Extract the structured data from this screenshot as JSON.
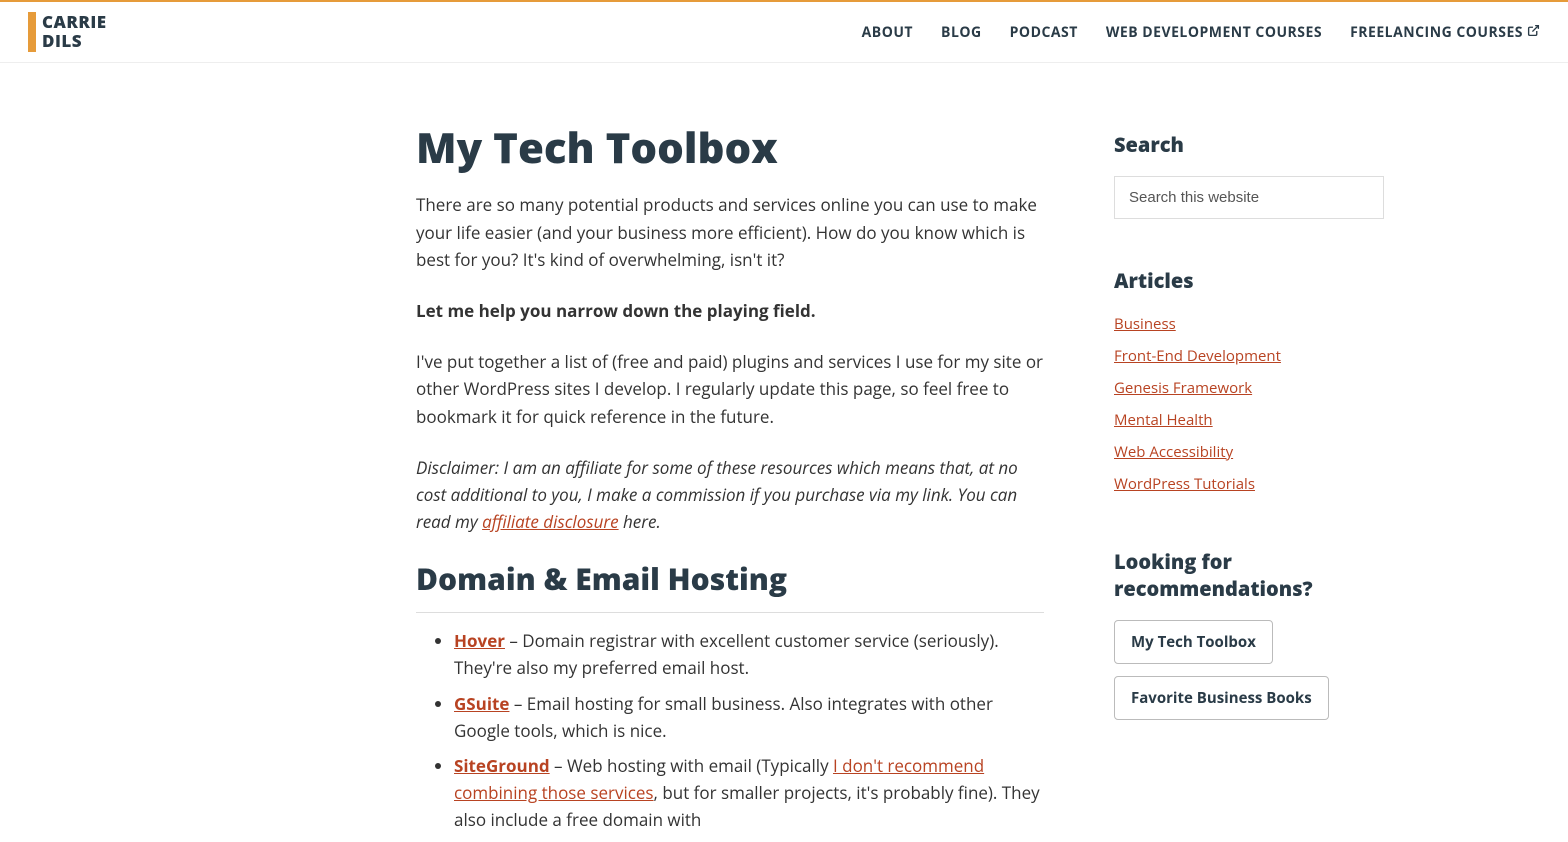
{
  "logo": {
    "line1": "CARRIE",
    "line2": "DILS"
  },
  "nav": {
    "items": [
      {
        "label": "ABOUT"
      },
      {
        "label": "BLOG"
      },
      {
        "label": "PODCAST"
      },
      {
        "label": "WEB DEVELOPMENT COURSES"
      },
      {
        "label": "FREELANCING COURSES",
        "external": true
      }
    ]
  },
  "main": {
    "title": "My Tech Toolbox",
    "intro": "There are so many potential products and services online you can use to make your life easier (and your business more efficient). How do you know which is best for you? It's kind of overwhelming, isn't it?",
    "bold_line": "Let me help you narrow down the playing field.",
    "para2": "I've put together a list of (free and paid) plugins and services I use for my site or other WordPress sites I develop. I regularly update this page, so feel free to bookmark it for quick reference in the future.",
    "disclaimer_pre": "Disclaimer: I am an affiliate for some of these resources which means that, at no cost additional to you, I make a commission if you purchase via my link. You can read my ",
    "disclaimer_link": "affiliate disclosure",
    "disclaimer_post": " here.",
    "section_heading": "Domain & Email Hosting",
    "list": {
      "item1": {
        "link": "Hover",
        "text": " – Domain registrar with excellent customer service (seriously). They're also my preferred email host."
      },
      "item2": {
        "link": "GSuite",
        "text": " – Email hosting for small business. Also integrates with other Google tools, which is nice."
      },
      "item3": {
        "link": "SiteGround",
        "pre": " – Web hosting with email (Typically ",
        "inlink": "I don't recommend combining those services",
        "post": ", but for smaller projects, it's probably fine). They also include a free domain with"
      }
    }
  },
  "sidebar": {
    "search_heading": "Search",
    "search_placeholder": "Search this website",
    "articles_heading": "Articles",
    "articles": [
      "Business",
      "Front-End Development",
      "Genesis Framework",
      "Mental Health",
      "Web Accessibility",
      "WordPress Tutorials"
    ],
    "rec_heading": "Looking for recommendations?",
    "rec_buttons": [
      "My Tech Toolbox",
      "Favorite Business Books"
    ]
  }
}
